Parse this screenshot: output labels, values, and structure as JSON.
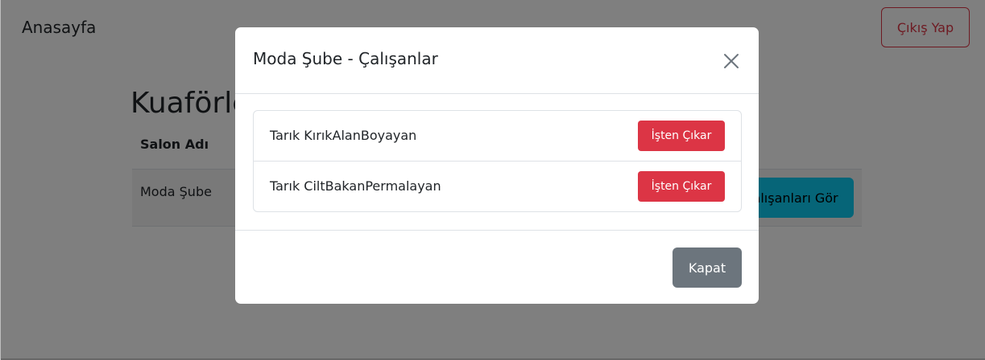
{
  "navbar": {
    "brand": "Anasayfa",
    "logout_label": "Çıkış Yap"
  },
  "page": {
    "heading": "Kuaförler",
    "table": {
      "headers": [
        "Salon Adı"
      ],
      "rows": [
        {
          "name": "Moda Şube",
          "action_label": "Çalışanları Gör"
        }
      ]
    }
  },
  "modal": {
    "title": "Moda Şube - Çalışanlar",
    "close_icon": "close-icon",
    "employees": [
      {
        "name": "Tarık KırıkAlanBoyayan",
        "action_label": "İşten Çıkar"
      },
      {
        "name": "Tarık CiltBakanPermalayan",
        "action_label": "İşten Çıkar"
      }
    ],
    "footer_close_label": "Kapat"
  },
  "colors": {
    "danger": "#dc3545",
    "info": "#0dcaf0",
    "secondary": "#6c757d",
    "backdrop": "rgba(0,0,0,0.5)"
  }
}
